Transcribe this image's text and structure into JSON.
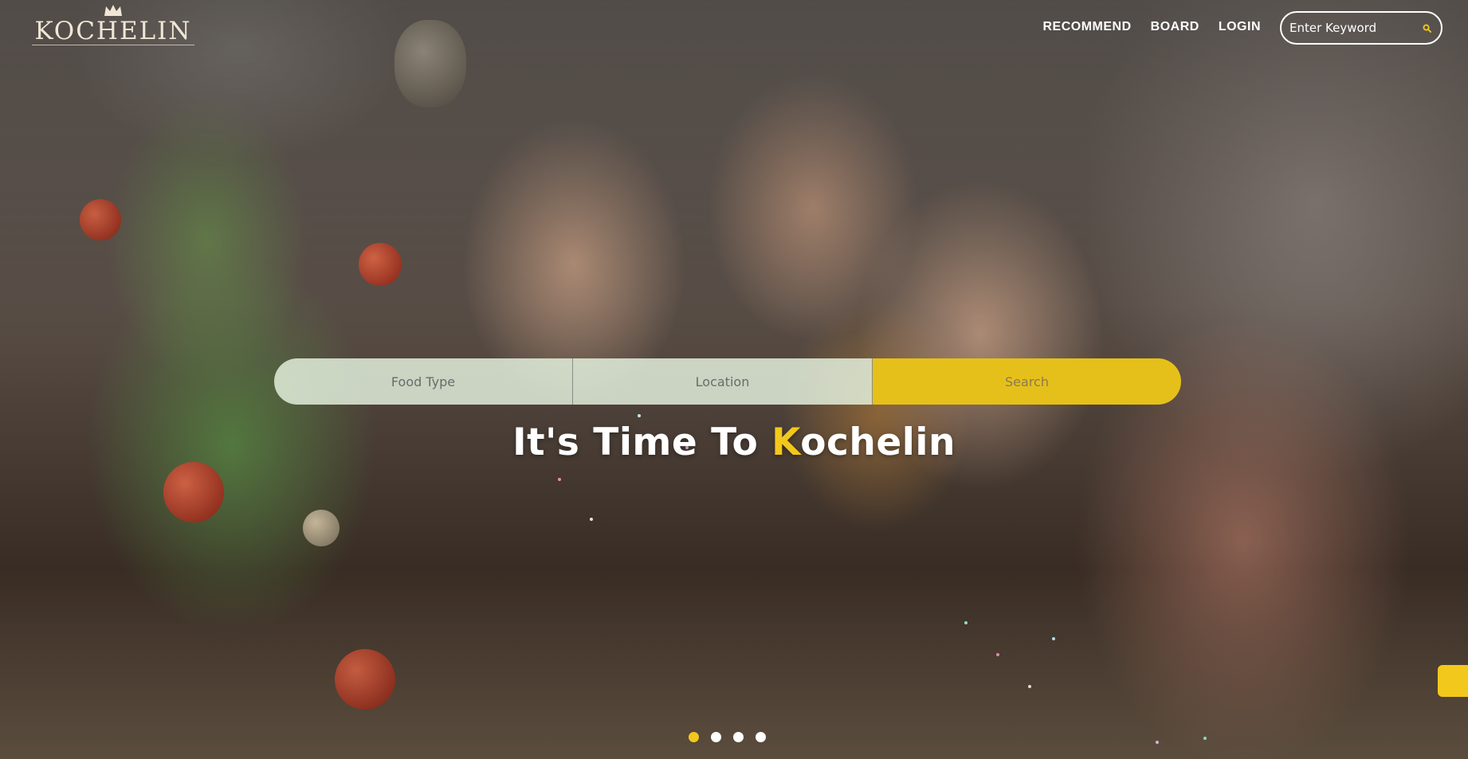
{
  "brand": {
    "name": "KOCHELIN",
    "logo_icon": "crown-icon"
  },
  "nav": {
    "items": [
      {
        "label": "RECOMMEND"
      },
      {
        "label": "BOARD"
      },
      {
        "label": "LOGIN"
      }
    ]
  },
  "header_search": {
    "placeholder": "Enter Keyword",
    "icon": "search-icon"
  },
  "filter": {
    "food_type_placeholder": "Food Type",
    "location_placeholder": "Location",
    "search_label": "Search"
  },
  "headline": {
    "prefix": "It's Time To ",
    "accent": "K",
    "suffix": "ochelin"
  },
  "carousel": {
    "slide_count": 4,
    "active_index": 0
  },
  "colors": {
    "accent": "#f3c81c",
    "search_button": "#e6c01a",
    "text": "#ffffff"
  }
}
